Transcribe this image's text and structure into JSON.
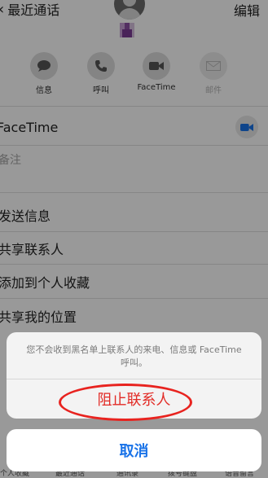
{
  "nav": {
    "back_label": "最近通话",
    "edit_label": "编辑"
  },
  "actions": [
    {
      "label": "信息",
      "icon": "message-icon",
      "enabled": true
    },
    {
      "label": "呼叫",
      "icon": "phone-icon",
      "enabled": true
    },
    {
      "label": "FaceTime",
      "icon": "video-icon",
      "enabled": true
    },
    {
      "label": "邮件",
      "icon": "mail-icon",
      "enabled": false
    }
  ],
  "details": {
    "facetime_label": "FaceTime",
    "note_label": "备注",
    "rows": [
      "发送信息",
      "共享联系人",
      "添加到个人收藏",
      "共享我的位置"
    ]
  },
  "tabbar": [
    "个人收藏",
    "最近通话",
    "通讯录",
    "拨号键盘",
    "语音留言"
  ],
  "sheet": {
    "message": "您不会收到黑名单上联系人的来电、信息或 FaceTime 呼叫。",
    "block_label": "阻止联系人",
    "cancel_label": "取消"
  },
  "colors": {
    "destructive": "#e22b26",
    "cancel": "#1a73e8",
    "annotation": "#e8231f",
    "accent_video": "#1a73e8"
  }
}
